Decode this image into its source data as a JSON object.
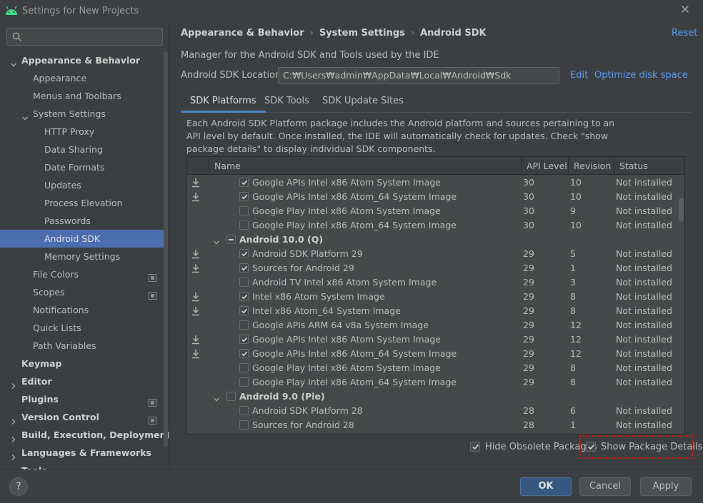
{
  "window": {
    "title": "Settings for New Projects"
  },
  "sidebar": {
    "search_placeholder": "",
    "items": [
      {
        "label": "Appearance & Behavior",
        "level": 0,
        "expanded": true,
        "bold": true
      },
      {
        "label": "Appearance",
        "level": 1
      },
      {
        "label": "Menus and Toolbars",
        "level": 1
      },
      {
        "label": "System Settings",
        "level": 1,
        "expanded": true
      },
      {
        "label": "HTTP Proxy",
        "level": 2
      },
      {
        "label": "Data Sharing",
        "level": 2
      },
      {
        "label": "Date Formats",
        "level": 2
      },
      {
        "label": "Updates",
        "level": 2
      },
      {
        "label": "Process Elevation",
        "level": 2
      },
      {
        "label": "Passwords",
        "level": 2
      },
      {
        "label": "Android SDK",
        "level": 2,
        "selected": true
      },
      {
        "label": "Memory Settings",
        "level": 2
      },
      {
        "label": "File Colors",
        "level": 1,
        "project_icon": true
      },
      {
        "label": "Scopes",
        "level": 1,
        "project_icon": true
      },
      {
        "label": "Notifications",
        "level": 1
      },
      {
        "label": "Quick Lists",
        "level": 1
      },
      {
        "label": "Path Variables",
        "level": 1
      },
      {
        "label": "Keymap",
        "level": 0,
        "bold": true
      },
      {
        "label": "Editor",
        "level": 0,
        "collapsed": true,
        "bold": true
      },
      {
        "label": "Plugins",
        "level": 0,
        "project_icon": true,
        "bold": true
      },
      {
        "label": "Version Control",
        "level": 0,
        "collapsed": true,
        "project_icon": true,
        "bold": true
      },
      {
        "label": "Build, Execution, Deployment",
        "level": 0,
        "collapsed": true,
        "bold": true
      },
      {
        "label": "Languages & Frameworks",
        "level": 0,
        "collapsed": true,
        "bold": true
      },
      {
        "label": "Tools",
        "level": 0,
        "collapsed": true,
        "bold": true
      }
    ]
  },
  "breadcrumb": [
    "Appearance & Behavior",
    "System Settings",
    "Android SDK"
  ],
  "reset_label": "Reset",
  "description": "Manager for the Android SDK and Tools used by the IDE",
  "sdk_location": {
    "label": "Android SDK Location:",
    "value": "C:₩Users₩admin₩AppData₩Local₩Android₩Sdk",
    "edit_label": "Edit",
    "optimize_label": "Optimize disk space"
  },
  "tabs": [
    {
      "label": "SDK Platforms",
      "active": true
    },
    {
      "label": "SDK Tools"
    },
    {
      "label": "SDK Update Sites"
    }
  ],
  "info_text": "Each Android SDK Platform package includes the Android platform and sources pertaining to an API level by default. Once installed, the IDE will automatically check for updates. Check \"show package details\" to display individual SDK components.",
  "table": {
    "columns": [
      "Name",
      "API Level",
      "Revision",
      "Status"
    ],
    "rows": [
      {
        "download": true,
        "checked": true,
        "name": "Google APIs Intel x86 Atom System Image",
        "api": "30",
        "revision": "10",
        "status": "Not installed"
      },
      {
        "download": true,
        "checked": true,
        "name": "Google APIs Intel x86 Atom_64 System Image",
        "api": "30",
        "revision": "10",
        "status": "Not installed"
      },
      {
        "checked": false,
        "name": "Google Play Intel x86 Atom System Image",
        "api": "30",
        "revision": "9",
        "status": "Not installed"
      },
      {
        "checked": false,
        "name": "Google Play Intel x86 Atom_64 System Image",
        "api": "30",
        "revision": "10",
        "status": "Not installed"
      },
      {
        "group": true,
        "partial": true,
        "name": "Android 10.0 (Q)"
      },
      {
        "download": true,
        "checked": true,
        "name": "Android SDK Platform 29",
        "api": "29",
        "revision": "5",
        "status": "Not installed"
      },
      {
        "download": true,
        "checked": true,
        "name": "Sources for Android 29",
        "api": "29",
        "revision": "1",
        "status": "Not installed"
      },
      {
        "checked": false,
        "name": "Android TV Intel x86 Atom System Image",
        "api": "29",
        "revision": "3",
        "status": "Not installed"
      },
      {
        "download": true,
        "checked": true,
        "name": "Intel x86 Atom System Image",
        "api": "29",
        "revision": "8",
        "status": "Not installed"
      },
      {
        "download": true,
        "checked": true,
        "name": "Intel x86 Atom_64 System Image",
        "api": "29",
        "revision": "8",
        "status": "Not installed"
      },
      {
        "checked": false,
        "name": "Google APIs ARM 64 v8a System Image",
        "api": "29",
        "revision": "12",
        "status": "Not installed"
      },
      {
        "download": true,
        "checked": true,
        "name": "Google APIs Intel x86 Atom System Image",
        "api": "29",
        "revision": "12",
        "status": "Not installed"
      },
      {
        "download": true,
        "checked": true,
        "name": "Google APIs Intel x86 Atom_64 System Image",
        "api": "29",
        "revision": "12",
        "status": "Not installed"
      },
      {
        "checked": false,
        "name": "Google Play Intel x86 Atom System Image",
        "api": "29",
        "revision": "8",
        "status": "Not installed"
      },
      {
        "checked": false,
        "name": "Google Play Intel x86 Atom_64 System Image",
        "api": "29",
        "revision": "8",
        "status": "Not installed"
      },
      {
        "group": true,
        "partial": false,
        "name": "Android 9.0 (Pie)"
      },
      {
        "checked": false,
        "name": "Android SDK Platform 28",
        "api": "28",
        "revision": "6",
        "status": "Not installed"
      },
      {
        "checked": false,
        "name": "Sources for Android 28",
        "api": "28",
        "revision": "1",
        "status": "Not installed"
      }
    ]
  },
  "options": {
    "hide_obsolete": {
      "label": "Hide Obsolete Packages",
      "checked": true
    },
    "show_details": {
      "label": "Show Package Details",
      "checked": true
    }
  },
  "footer": {
    "help": "?",
    "ok": "OK",
    "cancel": "Cancel",
    "apply": "Apply"
  },
  "colors": {
    "accent": "#4b6eaf",
    "link": "#589df6",
    "highlight": "#e01010"
  }
}
